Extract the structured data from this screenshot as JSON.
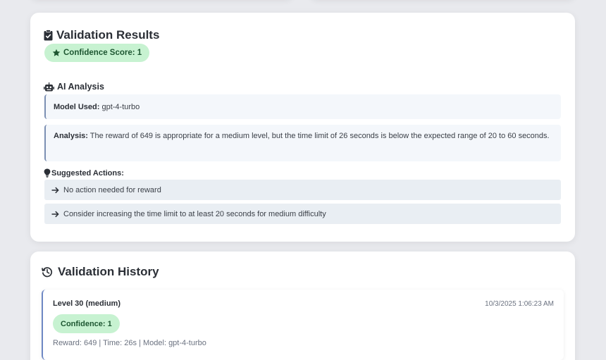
{
  "results": {
    "title": "Validation Results",
    "confidence_label": "Confidence Score: 1",
    "ai_heading": "AI Analysis",
    "model_label": "Model Used:",
    "model_value": "gpt-4-turbo",
    "analysis_label": "Analysis:",
    "analysis_text": "The reward of 649 is appropriate for a medium level, but the time limit of 26 seconds is below the expected range of 20 to 60 seconds.",
    "suggested_heading": "Suggested Actions:",
    "actions": [
      "No action needed for reward",
      "Consider increasing the time limit to at least 20 seconds for medium difficulty"
    ]
  },
  "history": {
    "title": "Validation History",
    "entries": [
      {
        "level": "Level 30 (medium)",
        "timestamp": "10/3/2025 1:06:23 AM",
        "confidence": "Confidence: 1",
        "meta": "Reward: 649 | Time: 26s | Model: gpt-4-turbo"
      }
    ]
  },
  "icons": {
    "results": "clipboard-check-icon",
    "confidence": "star-icon",
    "ai": "robot-icon",
    "suggested": "lightbulb-icon",
    "action": "arrow-right-icon",
    "history": "history-icon"
  },
  "colors": {
    "badge_bg": "#c7f2d1",
    "badge_text": "#1d5631",
    "accent_border": "#7b8fb3",
    "action_bg": "#e9eef3"
  }
}
